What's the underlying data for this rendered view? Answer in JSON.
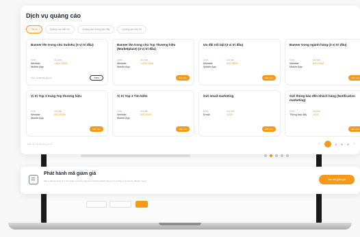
{
  "main": {
    "title": "Dịch vụ quảng cáo",
    "tabs": [
      {
        "label": "Tất cả",
        "active": true
      },
      {
        "label": "Quảng cáo hiển thị",
        "active": false
      },
      {
        "label": "Quảng cáo thông báo đẩy",
        "active": false
      },
      {
        "label": "Quảng cáo tiếp thị",
        "active": false
      }
    ],
    "services": [
      {
        "title": "Banner lên trong chủ Sudoku (3 vị trí đầu)",
        "k1": "Kênh",
        "k2": "Giá bán",
        "v1": "Website",
        "v2": "Mobile App",
        "price": "1.000.000đ",
        "action": "Đặt mua"
      },
      {
        "title": "Banner lên trong chủ Top Thương hiệu (Marketplace) (3 vị trí đầu)",
        "k1": "Kênh",
        "k2": "Giá bán",
        "v1": "Website",
        "v2": "Mobile App",
        "price": "1.000.000đ",
        "action": "Đặt mua"
      },
      {
        "title": "Ưu đãi nổi bật (3 vị trí đầu)",
        "k1": "Kênh",
        "k2": "Giá bán",
        "v1": "Website",
        "v2": "Mobile App",
        "price": "800.000đ",
        "action": "Đặt mua"
      },
      {
        "title": "Banner trong ngành hàng (3 vị trí đầu)",
        "k1": "Kênh",
        "k2": "Giá bán",
        "v1": "Website",
        "v2": "Mobile App",
        "price": "800.000đ",
        "action": "Đặt mua"
      },
      {
        "title": "Vị trí Top 3 trang Top thương hiệu",
        "k1": "Kênh",
        "k2": "Giá bán",
        "v1": "Website",
        "v2": "Mobile App",
        "price": "500.000đ",
        "action": "Đặt mua"
      },
      {
        "title": "Vị trí Top 3 Tìm kiếm",
        "k1": "Kênh",
        "k2": "Giá bán",
        "v1": "Website",
        "v2": "Mobile App",
        "price": "500.000đ",
        "action": "Đặt mua"
      },
      {
        "title": "Gửi email marketing",
        "k1": "Kênh",
        "k2": "Giá bán",
        "v1": "Email",
        "v2": "",
        "price": "100đ",
        "action": "Đặt mua"
      },
      {
        "title": "Gửi thông báo đến khách hàng (Notification marketing)",
        "k1": "Kênh",
        "k2": "Giá bán",
        "v1": "Thông báo đẩy",
        "v2": "",
        "price": "100đ",
        "action": "Đặt mua"
      }
    ],
    "first_card_extra": {
      "link": "Xem ưu đãi giá dịch vụ",
      "button": "Xem"
    },
    "footer_note": "Hiển thị 1-8 trên tổng số 12",
    "pager": {
      "current": "1",
      "next": "2"
    }
  },
  "promo": {
    "title": "Phát hành mã giảm giá",
    "desc": "Mã ưu đãi áp dụng cho sản phẩm của bạn, giúp thu hút thêm khách hàng mới và tăng tỷ lệ chuyển đổi đơn hàng.",
    "button": "Tạo mã giảm giá"
  },
  "laptop": {
    "filter_button": "Lọc"
  }
}
